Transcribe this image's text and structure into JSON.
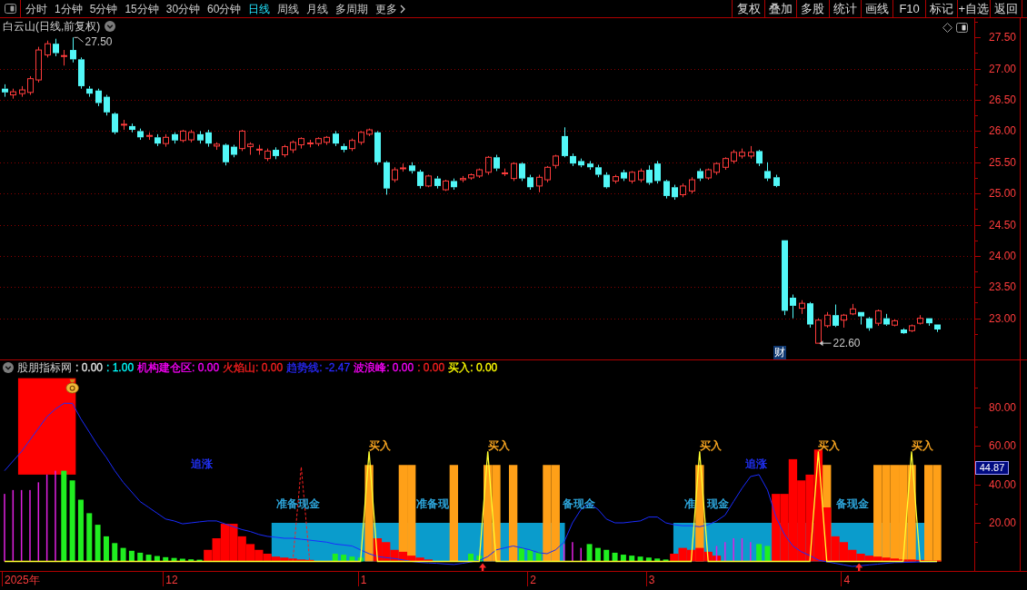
{
  "toolbar": {
    "tabs": [
      {
        "label": "分时",
        "kind": "period",
        "selected": false
      },
      {
        "label": "1分钟",
        "kind": "period",
        "selected": false
      },
      {
        "label": "5分钟",
        "kind": "period",
        "selected": false
      },
      {
        "label": "15分钟",
        "kind": "period",
        "selected": false
      },
      {
        "label": "30分钟",
        "kind": "period",
        "selected": false
      },
      {
        "label": "60分钟",
        "kind": "period",
        "selected": false
      },
      {
        "label": "日线",
        "kind": "period",
        "selected": true
      },
      {
        "label": "周线",
        "kind": "period",
        "selected": false
      },
      {
        "label": "月线",
        "kind": "period",
        "selected": false
      },
      {
        "label": "多周期",
        "kind": "period",
        "selected": false
      },
      {
        "label": "更多",
        "kind": "menu",
        "selected": false
      }
    ],
    "buttons": [
      "复权",
      "叠加",
      "多股",
      "统计",
      "画线",
      "F10",
      "标记",
      "+自选",
      "返回"
    ]
  },
  "price_chart": {
    "title": "白云山(日线,前复权)",
    "axis_labels": [
      "27.50",
      "27.00",
      "26.50",
      "26.00",
      "25.50",
      "25.00",
      "24.50",
      "24.00",
      "23.50",
      "23.00"
    ],
    "markers": [
      {
        "kind": "high",
        "text": "27.50"
      },
      {
        "kind": "low",
        "text": "22.60"
      },
      {
        "kind": "badge",
        "text": "财"
      }
    ]
  },
  "indicator": {
    "name": "股朋指标网",
    "legend": [
      {
        "text": ": 0.00",
        "color": "#e6e6e6"
      },
      {
        "text": ": 1.00",
        "color": "#00ffff"
      },
      {
        "text": "机构建仓区: 0.00",
        "color": "#ff00ff"
      },
      {
        "text": "火焰山: 0.00",
        "color": "#ff2020"
      },
      {
        "text": "趋势线: -2.47",
        "color": "#2a2aff"
      },
      {
        "text": "波浪峰: 0.00",
        "color": "#ff00ff"
      },
      {
        "text": ": 0.00",
        "color": "#ff2020"
      },
      {
        "text": "买入: 0.00",
        "color": "#ffff00"
      }
    ],
    "axis_labels": [
      "80.00",
      "60.00",
      "40.00",
      "20.00"
    ],
    "value_tag": "44.87",
    "labels": [
      {
        "kind": "label",
        "text": "追涨",
        "color": "#2233ff"
      },
      {
        "kind": "label",
        "text": "准备现金",
        "color": "#30aee6"
      },
      {
        "kind": "label",
        "text": "准备现",
        "color": "#30aee6"
      },
      {
        "kind": "label",
        "text": "备现金",
        "color": "#30aee6"
      },
      {
        "kind": "label",
        "text": "准",
        "color": "#30aee6"
      },
      {
        "kind": "label",
        "text": "现金",
        "color": "#30aee6"
      },
      {
        "kind": "label",
        "text": "追涨",
        "color": "#2233ff"
      },
      {
        "kind": "label",
        "text": "备现金",
        "color": "#30aee6"
      },
      {
        "kind": "signal",
        "text": "买入",
        "color": "#ffaa22"
      },
      {
        "kind": "signal",
        "text": "买入",
        "color": "#ffaa22"
      },
      {
        "kind": "signal",
        "text": "买入",
        "color": "#ffaa22"
      },
      {
        "kind": "signal",
        "text": "买入",
        "color": "#ffaa22"
      },
      {
        "kind": "signal",
        "text": "买入",
        "color": "#ffaa22"
      }
    ]
  },
  "date_axis": [
    "2025年",
    "12",
    "1",
    "2",
    "3",
    "4"
  ]
}
